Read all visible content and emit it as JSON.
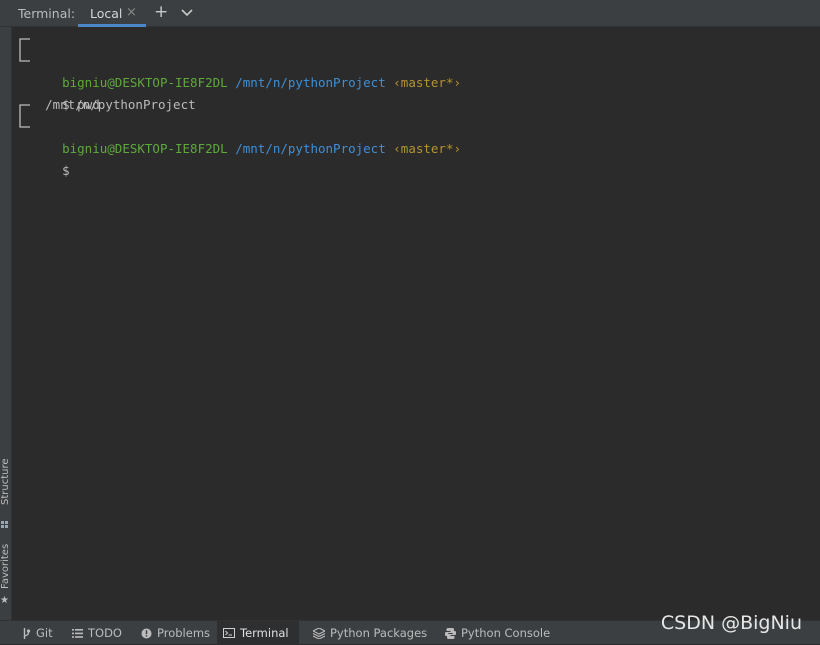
{
  "top_bar": {
    "label": "Terminal:",
    "tab": "Local",
    "close_glyph": "×",
    "new_tab_glyph": "+"
  },
  "left_strip": {
    "structure": "Structure",
    "favorites": "Favorites"
  },
  "terminal": {
    "lines": [
      {
        "user": "bigniu@DESKTOP-IE8F2DL",
        "path": "/mnt/n/pythonProject",
        "branch": "‹master*›"
      },
      {
        "prompt": "$",
        "command": "pwd"
      },
      {
        "output": "/mnt/n/pythonProject"
      },
      {
        "user": "bigniu@DESKTOP-IE8F2DL",
        "path": "/mnt/n/pythonProject",
        "branch": "‹master*›"
      },
      {
        "prompt": "$",
        "command": ""
      }
    ]
  },
  "bottom_bar": {
    "tabs": [
      {
        "label": "Git",
        "icon": "git-branch-icon"
      },
      {
        "label": "TODO",
        "icon": "todo-list-icon"
      },
      {
        "label": "Problems",
        "icon": "problems-icon"
      },
      {
        "label": "Terminal",
        "icon": "terminal-icon",
        "active": true
      },
      {
        "label": "Python Packages",
        "icon": "packages-icon"
      },
      {
        "label": "Python Console",
        "icon": "python-icon"
      }
    ]
  },
  "watermark": "CSDN @BigNiu",
  "colors": {
    "user": "#5fa83b",
    "path": "#3e8fd6",
    "branch": "#b39430",
    "active_tab_underline": "#4a88c7"
  }
}
